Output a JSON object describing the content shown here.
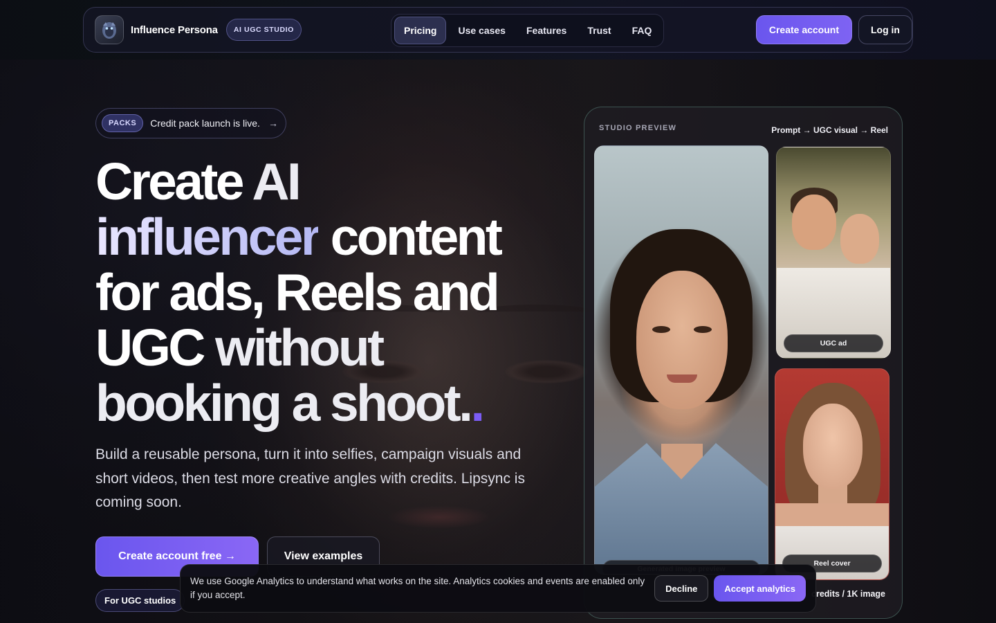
{
  "nav": {
    "brand_name": "Influence Persona",
    "brand_badge": "AI UGC STUDIO",
    "links": [
      {
        "label": "Pricing",
        "active": true
      },
      {
        "label": "Use cases",
        "active": false
      },
      {
        "label": "Features",
        "active": false
      },
      {
        "label": "Trust",
        "active": false
      },
      {
        "label": "FAQ",
        "active": false
      }
    ],
    "create_account": "Create account",
    "log_in": "Log in"
  },
  "hero": {
    "announcement_tag": "PACKS",
    "announcement_text": "Credit pack launch is live.",
    "announcement_arrow": "→",
    "headline": {
      "line1a": "Create ",
      "line1b": "AI",
      "line2a": "influencer",
      "line2b": " content",
      "line3": "for ads, Reels and",
      "line4a": "UGC",
      "line4b": " without",
      "line5": "booking a shoot.",
      "dot": "."
    },
    "subtitle": "Build a reusable persona, turn it into selfies, campaign visuals and short videos, then test more creative angles with credits. Lipsync is coming soon.",
    "cta_primary": "Create account free →",
    "cta_secondary": "View examples",
    "chip_studios": "For UGC studios"
  },
  "studio": {
    "label": "STUDIO PREVIEW",
    "flow": "Prompt → UGC visual → Reel",
    "main_caption": "Generated image preview",
    "ugc_caption": "UGC ad",
    "reel_caption": "Reel cover",
    "credits_text": "credits / 1K image"
  },
  "cookie": {
    "text": "We use Google Analytics to understand what works on the site. Analytics cookies and events are enabled only if you accept.",
    "decline": "Decline",
    "accept": "Accept analytics"
  },
  "colors": {
    "accent": "#6a56ee",
    "accent_light": "#8a67f5",
    "background": "#0d0d12",
    "dot": "#7b5cf5"
  }
}
